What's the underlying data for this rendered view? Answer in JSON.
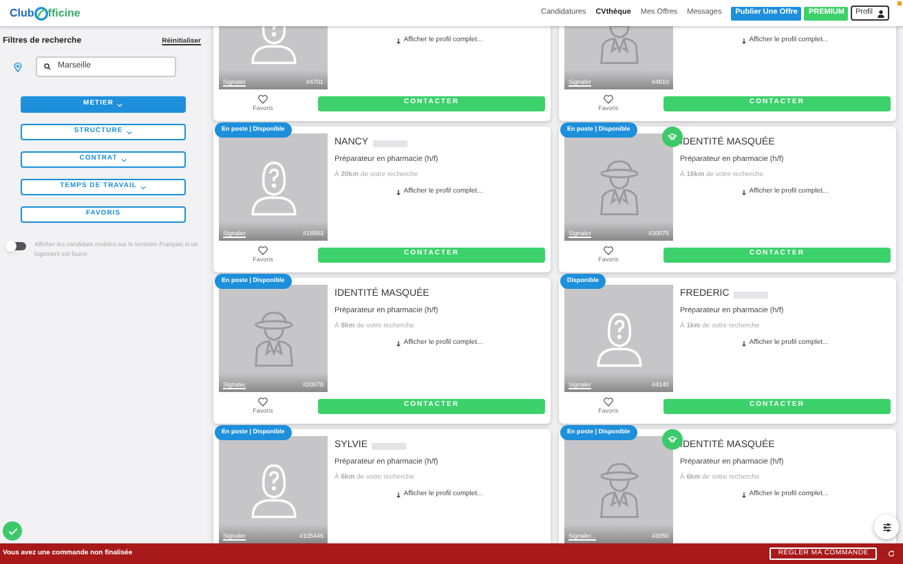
{
  "header": {
    "logo": {
      "part1": "Club",
      "part2": "fficine"
    },
    "nav": [
      {
        "label": "Candidatures",
        "selected": false
      },
      {
        "label": "CVthèque",
        "selected": true
      },
      {
        "label": "Mes Offres",
        "selected": false
      },
      {
        "label": "Messages",
        "selected": false
      }
    ],
    "publish_button": "Publier Une Offre",
    "premium_button": "PREMIUM",
    "profile_button": "Profil"
  },
  "sidebar": {
    "title": "Filtres de recherche",
    "reset": "Réinitialiser",
    "search": {
      "value": "Marseille"
    },
    "filters": [
      {
        "label": "METIER",
        "selected": true,
        "dropdown": true
      },
      {
        "label": "STRUCTURE",
        "selected": false,
        "dropdown": true
      },
      {
        "label": "CONTRAT",
        "selected": false,
        "dropdown": true
      },
      {
        "label": "TEMPS DE TRAVAIL",
        "selected": false,
        "dropdown": true
      },
      {
        "label": "FAVORIS",
        "selected": false,
        "dropdown": false
      }
    ],
    "toggle": {
      "on": false,
      "label": "Afficher les candidats mobiles sur le territoire Français si un logement est fourni"
    }
  },
  "cards": [
    {
      "kind": "unknown",
      "link": "Afficher le profil complet...",
      "report": "Signaler",
      "id": "#4701",
      "favorite": "Favoris",
      "contact": "CONTACTER"
    },
    {
      "kind": "masked",
      "link": "Afficher le profil complet...",
      "report": "Signaler",
      "id": "#4610",
      "favorite": "Favoris",
      "contact": "CONTACTER"
    },
    {
      "status": "En poste | Disponible",
      "kind": "unknown",
      "certified": false,
      "name": "NANCY",
      "job": "Préparateur en pharmacie (h/f)",
      "distance": "À **20km** de votre recherche",
      "link": "Afficher le profil complet...",
      "report": "Signaler",
      "id": "#18563",
      "favorite": "Favoris",
      "contact": "CONTACTER"
    },
    {
      "status": "En poste | Disponible",
      "kind": "masked",
      "certified": true,
      "name": "IDENTITÉ MASQUÉE",
      "job": "Préparateur en pharmacie (h/f)",
      "distance": "À **16km** de votre recherche",
      "link": "Afficher le profil complet...",
      "report": "Signaler",
      "id": "#30075",
      "favorite": "Favoris",
      "contact": "CONTACTER"
    },
    {
      "status": "En poste | Disponible",
      "kind": "masked",
      "certified": false,
      "name": "IDENTITÉ MASQUÉE",
      "job": "Préparateur en pharmacie (h/f)",
      "distance": "À **8km** de votre recherche",
      "link": "Afficher le profil complet...",
      "report": "Signaler",
      "id": "#20078",
      "favorite": "Favoris",
      "contact": "CONTACTER"
    },
    {
      "status": "Disponible",
      "kind": "unknown",
      "certified": false,
      "name": "FREDERIC",
      "job": "Préparateur en pharmacie (h/f)",
      "distance": "À **1km** de votre recherche",
      "link": "Afficher le profil complet...",
      "report": "Signaler",
      "id": "#4140",
      "favorite": "Favoris",
      "contact": "CONTACTER"
    },
    {
      "status": "En poste | Disponible",
      "kind": "unknown",
      "certified": false,
      "name": "SYLVIE",
      "job": "Préparateur en pharmacie (h/f)",
      "distance": "À **6km** de votre recherche",
      "link": "Afficher le profil complet...",
      "report": "Signaler",
      "id": "#105446"
    },
    {
      "status": "En poste | Disponible",
      "kind": "masked",
      "certified": true,
      "name": "IDENTITÉ MASQUÉE",
      "job": "Préparateur en pharmacie (h/f)",
      "distance": "À **6km** de votre recherche",
      "link": "Afficher le profil complet...",
      "report": "Signaler...",
      "id": "#3050"
    }
  ],
  "alert_bar": {
    "message": "Vous avez une commande non finalisée",
    "button": "REGLER MA COMMANDE"
  }
}
